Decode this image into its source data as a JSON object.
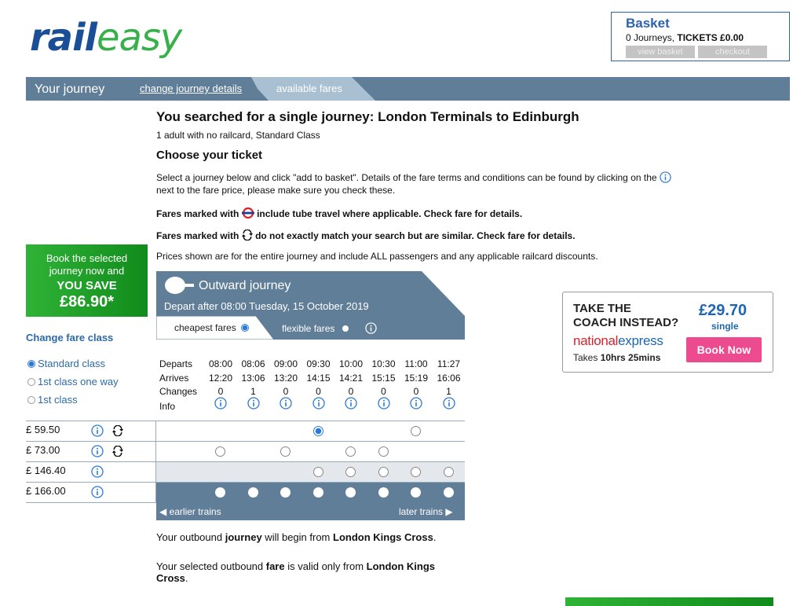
{
  "logo": {
    "part1": "rail",
    "part2": "easy"
  },
  "basket": {
    "title": "Basket",
    "journeys": "0 Journeys, ",
    "tickets": "TICKETS £0.00",
    "view": "view basket",
    "checkout": "checkout"
  },
  "nav": {
    "title": "Your journey",
    "change": "change journey details",
    "fares": "available fares"
  },
  "search": {
    "heading": "You searched for a single journey: London Terminals to Edinburgh",
    "sub": "1 adult with no railcard, Standard Class",
    "choose": "Choose your ticket",
    "select_text": "Select a journey below and click \"add to basket\". Details of the fare terms and conditions can be found by clicking on the",
    "select_text2": "next to the fare price, please make sure you check these.",
    "tube_pre": "Fares marked with",
    "tube_post": "include tube travel where applicable. Check fare for details.",
    "sim_pre": "Fares marked with",
    "sim_post": "do not exactly match your search but are similar. Check fare for details.",
    "prices": "Prices shown are for the entire journey and include ALL passengers and any applicable railcard discounts."
  },
  "save": {
    "l1": "Book the selected",
    "l2": "journey now and",
    "l3": "YOU SAVE",
    "amount": "£86.90*"
  },
  "fare_class": {
    "title": "Change fare class",
    "options": [
      "Standard class",
      "1st class one way",
      "1st class"
    ]
  },
  "outward": {
    "title": "Outward journey",
    "sub": "Depart after 08:00 Tuesday, 15 October 2019",
    "tab_cheap": "cheapest fares",
    "tab_flex": "flexible fares"
  },
  "timetable": {
    "labels": [
      "Departs",
      "Arrives",
      "Changes",
      "Info"
    ],
    "departs": [
      "08:00",
      "08:06",
      "09:00",
      "09:30",
      "10:00",
      "10:30",
      "11:00",
      "11:27"
    ],
    "arrives": [
      "12:20",
      "13:06",
      "13:20",
      "14:15",
      "14:21",
      "15:15",
      "15:19",
      "16:06"
    ],
    "changes": [
      "0",
      "1",
      "0",
      "0",
      "0",
      "0",
      "0",
      "1"
    ]
  },
  "fares": [
    {
      "price": "£ 59.50"
    },
    {
      "price": "£ 73.00"
    },
    {
      "price": "£ 146.40"
    },
    {
      "price": "£ 166.00"
    }
  ],
  "nav_trains": {
    "earlier": "earlier trains",
    "later": "later trains"
  },
  "messages": {
    "m1_a": "Your outbound ",
    "m1_b": "journey",
    "m1_c": " will begin from ",
    "m1_d": "London Kings Cross",
    "m1_e": ".",
    "m2_a": "Your selected outbound ",
    "m2_b": "fare",
    "m2_c": " is valid only from ",
    "m2_d": "London Kings Cross",
    "m2_e": "."
  },
  "coach": {
    "h1": "TAKE THE",
    "h2": "COACH INSTEAD?",
    "price": "£29.70",
    "single": "single",
    "brand1": "national",
    "brand2": "express",
    "takes_a": "Takes ",
    "takes_b": "10hrs 25mins",
    "book": "Book Now"
  },
  "colors": {
    "bar": "#607e97",
    "accent": "#2b62b3",
    "green": "#2fb336",
    "pink": "#ec4b8f"
  }
}
